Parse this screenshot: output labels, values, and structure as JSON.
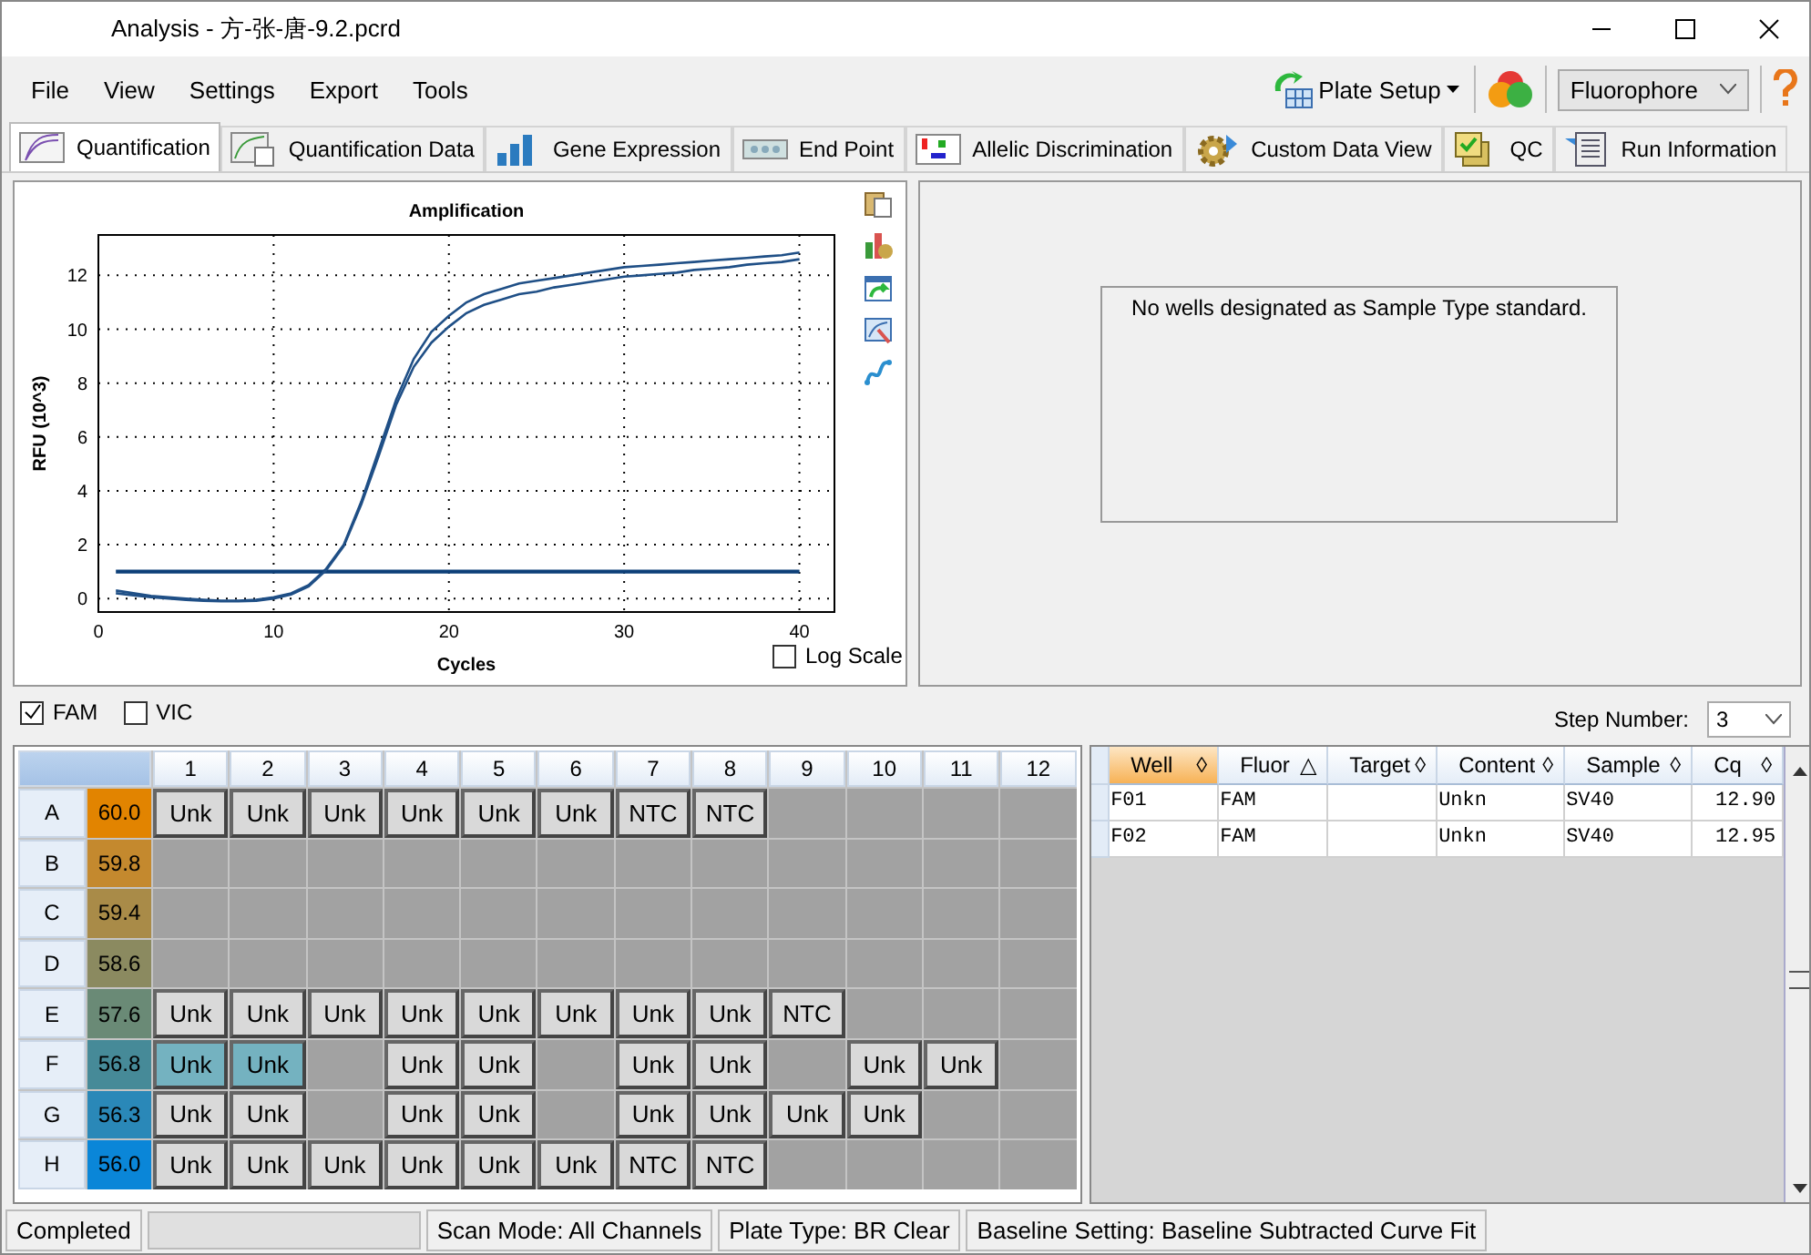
{
  "window": {
    "title": "Analysis - 方-张-唐-9.2.pcrd"
  },
  "menu": [
    "File",
    "View",
    "Settings",
    "Export",
    "Tools"
  ],
  "toolbar": {
    "plate_setup": "Plate Setup",
    "fluorophore": "Fluorophore"
  },
  "tabs": [
    {
      "label": "Quantification",
      "selected": true
    },
    {
      "label": "Quantification Data",
      "selected": false
    },
    {
      "label": "Gene Expression",
      "selected": false
    },
    {
      "label": "End Point",
      "selected": false
    },
    {
      "label": "Allelic Discrimination",
      "selected": false
    },
    {
      "label": "Custom Data View",
      "selected": false
    },
    {
      "label": "QC",
      "selected": false
    },
    {
      "label": "Run Information",
      "selected": false
    }
  ],
  "chart": {
    "chart_data": {
      "type": "line",
      "title": "Amplification",
      "xlabel": "Cycles",
      "ylabel": "RFU (10^3)",
      "x": [
        1,
        2,
        3,
        4,
        5,
        6,
        7,
        8,
        9,
        10,
        11,
        12,
        13,
        14,
        15,
        16,
        17,
        18,
        19,
        20,
        21,
        22,
        23,
        24,
        25,
        26,
        27,
        28,
        29,
        30,
        31,
        32,
        33,
        34,
        35,
        36,
        37,
        38,
        39,
        40
      ],
      "xlim": [
        0,
        42
      ],
      "ylim": [
        -0.5,
        13.5
      ],
      "grid": true,
      "xticks": [
        0,
        10,
        20,
        30,
        40
      ],
      "yticks": [
        0,
        2,
        4,
        6,
        8,
        10,
        12
      ],
      "series": [
        {
          "color": "#1f4f86",
          "values": [
            0.3,
            0.2,
            0.1,
            0.05,
            0,
            -0.05,
            -0.08,
            -0.08,
            -0.05,
            0.05,
            0.2,
            0.5,
            1.1,
            2.0,
            3.6,
            5.5,
            7.4,
            8.9,
            9.9,
            10.5,
            11.0,
            11.3,
            11.5,
            11.7,
            11.8,
            11.9,
            12.0,
            12.1,
            12.2,
            12.3,
            12.35,
            12.4,
            12.45,
            12.5,
            12.55,
            12.6,
            12.65,
            12.7,
            12.75,
            12.85
          ]
        },
        {
          "color": "#0d3f78",
          "values": [
            1,
            1,
            1,
            1,
            1,
            1,
            1,
            1,
            1,
            1,
            1,
            1,
            1,
            1,
            1,
            1,
            1,
            1,
            1,
            1,
            1,
            1,
            1,
            1,
            1,
            1,
            1,
            1,
            1,
            1,
            1,
            1,
            1,
            1,
            1,
            1,
            1,
            1,
            1,
            1
          ]
        },
        {
          "color": "#1f4f86",
          "values": [
            0.2,
            0.12,
            0.05,
            0,
            -0.05,
            -0.08,
            -0.1,
            -0.1,
            -0.08,
            0,
            0.15,
            0.45,
            1.05,
            1.95,
            3.5,
            5.3,
            7.2,
            8.6,
            9.5,
            10.1,
            10.6,
            10.9,
            11.1,
            11.3,
            11.4,
            11.55,
            11.65,
            11.75,
            11.85,
            11.95,
            12.0,
            12.05,
            12.1,
            12.2,
            12.25,
            12.3,
            12.4,
            12.45,
            12.5,
            12.6
          ]
        }
      ]
    },
    "log_scale": {
      "label": "Log Scale",
      "checked": false
    }
  },
  "standard_curve": {
    "message": "No wells designated as Sample Type standard."
  },
  "channels": [
    {
      "label": "FAM",
      "checked": true
    },
    {
      "label": "VIC",
      "checked": false
    }
  ],
  "step_number": {
    "label": "Step Number:",
    "value": "3"
  },
  "plate": {
    "columns": [
      "1",
      "2",
      "3",
      "4",
      "5",
      "6",
      "7",
      "8",
      "9",
      "10",
      "11",
      "12"
    ],
    "rows": [
      {
        "label": "A",
        "temperature": "60.0",
        "color": "#e28400",
        "wells": [
          {
            "content": "Unk",
            "selected": false
          },
          {
            "content": "Unk",
            "selected": false
          },
          {
            "content": "Unk",
            "selected": false
          },
          {
            "content": "Unk",
            "selected": false
          },
          {
            "content": "Unk",
            "selected": false
          },
          {
            "content": "Unk",
            "selected": false
          },
          {
            "content": "NTC",
            "selected": false
          },
          {
            "content": "NTC",
            "selected": false
          },
          {
            "selected": false
          },
          {
            "selected": false
          },
          {
            "selected": false
          },
          {
            "selected": false
          }
        ]
      },
      {
        "label": "B",
        "temperature": "59.8",
        "color": "#c4892e",
        "wells": [
          {
            "selected": false
          },
          {
            "selected": false
          },
          {
            "selected": false
          },
          {
            "selected": false
          },
          {
            "selected": false
          },
          {
            "selected": false
          },
          {
            "selected": false
          },
          {
            "selected": false
          },
          {
            "selected": false
          },
          {
            "selected": false
          },
          {
            "selected": false
          },
          {
            "selected": false
          }
        ]
      },
      {
        "label": "C",
        "temperature": "59.4",
        "color": "#a98b48",
        "wells": [
          {
            "selected": false
          },
          {
            "selected": false
          },
          {
            "selected": false
          },
          {
            "selected": false
          },
          {
            "selected": false
          },
          {
            "selected": false
          },
          {
            "selected": false
          },
          {
            "selected": false
          },
          {
            "selected": false
          },
          {
            "selected": false
          },
          {
            "selected": false
          },
          {
            "selected": false
          }
        ]
      },
      {
        "label": "D",
        "temperature": "58.6",
        "color": "#8b8a60",
        "wells": [
          {
            "selected": false
          },
          {
            "selected": false
          },
          {
            "selected": false
          },
          {
            "selected": false
          },
          {
            "selected": false
          },
          {
            "selected": false
          },
          {
            "selected": false
          },
          {
            "selected": false
          },
          {
            "selected": false
          },
          {
            "selected": false
          },
          {
            "selected": false
          },
          {
            "selected": false
          }
        ]
      },
      {
        "label": "E",
        "temperature": "57.6",
        "color": "#6a8a76",
        "wells": [
          {
            "content": "Unk",
            "selected": false
          },
          {
            "content": "Unk",
            "selected": false
          },
          {
            "content": "Unk",
            "selected": false
          },
          {
            "content": "Unk",
            "selected": false
          },
          {
            "content": "Unk",
            "selected": false
          },
          {
            "content": "Unk",
            "selected": false
          },
          {
            "content": "Unk",
            "selected": false
          },
          {
            "content": "Unk",
            "selected": false
          },
          {
            "content": "NTC",
            "selected": false
          },
          {
            "selected": false
          },
          {
            "selected": false
          },
          {
            "selected": false
          }
        ]
      },
      {
        "label": "F",
        "temperature": "56.8",
        "color": "#468a98",
        "wells": [
          {
            "content": "Unk",
            "selected": true
          },
          {
            "content": "Unk",
            "selected": true
          },
          {
            "selected": false
          },
          {
            "content": "Unk",
            "selected": false
          },
          {
            "content": "Unk",
            "selected": false
          },
          {
            "selected": false
          },
          {
            "content": "Unk",
            "selected": false
          },
          {
            "content": "Unk",
            "selected": false
          },
          {
            "selected": false
          },
          {
            "content": "Unk",
            "selected": false
          },
          {
            "content": "Unk",
            "selected": false
          },
          {
            "selected": false
          }
        ]
      },
      {
        "label": "G",
        "temperature": "56.3",
        "color": "#2a88b8",
        "wells": [
          {
            "content": "Unk",
            "selected": false
          },
          {
            "content": "Unk",
            "selected": false
          },
          {
            "selected": false
          },
          {
            "content": "Unk",
            "selected": false
          },
          {
            "content": "Unk",
            "selected": false
          },
          {
            "selected": false
          },
          {
            "content": "Unk",
            "selected": false
          },
          {
            "content": "Unk",
            "selected": false
          },
          {
            "content": "Unk",
            "selected": false
          },
          {
            "content": "Unk",
            "selected": false
          },
          {
            "selected": false
          },
          {
            "selected": false
          }
        ]
      },
      {
        "label": "H",
        "temperature": "56.0",
        "color": "#0a86d8",
        "wells": [
          {
            "content": "Unk",
            "selected": false
          },
          {
            "content": "Unk",
            "selected": false
          },
          {
            "content": "Unk",
            "selected": false
          },
          {
            "content": "Unk",
            "selected": false
          },
          {
            "content": "Unk",
            "selected": false
          },
          {
            "content": "Unk",
            "selected": false
          },
          {
            "content": "NTC",
            "selected": false
          },
          {
            "content": "NTC",
            "selected": false
          },
          {
            "selected": false
          },
          {
            "selected": false
          },
          {
            "selected": false
          },
          {
            "selected": false
          }
        ]
      }
    ]
  },
  "table": {
    "columns": [
      {
        "label": "Well",
        "sort_mark": "◊",
        "selected": true
      },
      {
        "label": "Fluor",
        "sort_mark": "△",
        "selected": false
      },
      {
        "label": "Target",
        "sort_mark": "◊",
        "selected": false
      },
      {
        "label": "Content",
        "sort_mark": "◊",
        "selected": false
      },
      {
        "label": "Sample",
        "sort_mark": "◊",
        "selected": false
      },
      {
        "label": "Cq",
        "sort_mark": "◊",
        "selected": false
      }
    ],
    "rows": [
      {
        "well": "F01",
        "fluor": "FAM",
        "content": "Unkn",
        "sample": "SV40",
        "cq": "12.90"
      },
      {
        "well": "F02",
        "fluor": "FAM",
        "content": "Unkn",
        "sample": "SV40",
        "cq": "12.95"
      }
    ]
  },
  "status_bar": {
    "status": "Completed",
    "progress": {
      "level": 0
    },
    "scan_mode": "Scan Mode: All Channels",
    "plate_type": "Plate Type: BR Clear",
    "baseline": "Baseline Setting: Baseline Subtracted Curve Fit"
  }
}
